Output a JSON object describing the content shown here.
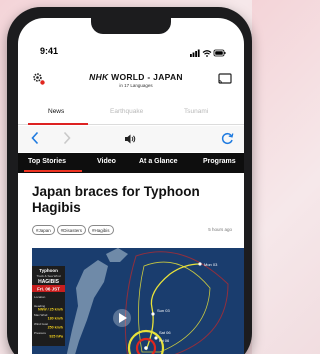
{
  "status_bar": {
    "time": "9:41"
  },
  "app_header": {
    "logo_brand": "NHK",
    "logo_title": "WORLD - JAPAN",
    "logo_subtitle": "in 17 Languages"
  },
  "top_tabs": [
    {
      "label": "News",
      "active": true
    },
    {
      "label": "Earthquake",
      "active": false
    },
    {
      "label": "Tsunami",
      "active": false
    }
  ],
  "section_tabs": [
    {
      "label": "Top Stories",
      "active": true
    },
    {
      "label": "Video"
    },
    {
      "label": "At a Glance"
    },
    {
      "label": "Programs"
    }
  ],
  "article": {
    "headline": "Japan braces for Typhoon Hagibis",
    "tags": [
      "#Japan",
      "#Disasters",
      "#Hagibis"
    ],
    "age": "5 hours ago"
  },
  "video": {
    "panel_title": "Typhoon",
    "panel_subtitle": "Track & Sea Wind",
    "storm_name": "HAGIBIS",
    "date_line": "Fri. 06 JST",
    "rows": [
      {
        "label": "Location",
        "value": ""
      },
      {
        "label": "Heading",
        "value": "NNW / 25 km/h"
      },
      {
        "label": "Max Wind",
        "value": "180 km/h"
      },
      {
        "label": "Wind Gust",
        "value": "250 km/h"
      },
      {
        "label": "Pressure",
        "value": "925 hPa"
      }
    ],
    "map_labels": [
      "Mon 03",
      "Sun 03",
      "Sat 06",
      "Fri 06"
    ],
    "colors": {
      "accent": "#e0261e",
      "panel": "#c81e1e",
      "map_ocean": "#1a3d6e",
      "track_yellow": "#e8e23a"
    }
  }
}
